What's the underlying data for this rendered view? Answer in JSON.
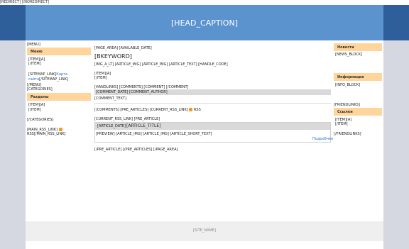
{
  "top": {
    "redirect": "[REDIRECT] [/NOREDIRECT]"
  },
  "header": {
    "caption": "[HEAD_CAPTION]"
  },
  "left": {
    "menu_tag": "[MENU]",
    "menu_title": "Меню",
    "menu_item_open": "[ITEM][A]",
    "menu_item_close": "[/ITEM]",
    "sitemap_open": "[SITEMAP_LINK]",
    "sitemap_link": "Карта",
    "sitemap_link2": "сайта",
    "sitemap_close": "[/SITEMAP_LINK]",
    "menu_close": "[/MENU]",
    "categories_tag": "[CATEGORIES]",
    "sections_title": "Разделы",
    "cat_item_open": "[ITEM][A]",
    "cat_item_close": "[/ITEM]",
    "categories_close": "[/CATEGORIES]",
    "main_rss": "[MAIN_RSS_LINK]",
    "main_rss_close": "RSS[/MAIN_RSS_LINK]"
  },
  "center": {
    "page_area": "[PAGE_AREA] [AVAILABLE_DATE]",
    "keyword": "[BKEYWORD]",
    "links_line": "[IMG_A_LT] [ARTICLE_IMG] [ARTICLE_IMG] [ARTICLE_TEXT] [HANDLE_CODE]",
    "item_a": "[ITEM][A]",
    "item_close": "[/ITEM]",
    "handlinks": "[HANDLINKS] [COMMENTS] [COMMENT] [/COMMENT]",
    "comment_row": "[COMMENT_DATE] [COMMENT_AUTHOR]",
    "comment_text": "[COMMENT_TEXT]",
    "comments_rss": "[/COMMENTS] [PRE_ARTICLES] [CURRENT_RSS_LINK]",
    "rss_word": "RSS",
    "current_rss": "[CURRENT_RSS_LINK] [PRE_ARTICLE]",
    "article_date": "[ARTICLE_DATE]",
    "article_title": "[ARTICLE_TITLE]",
    "article_short": "[PREVIEW] [ARTICLE_IMG] [ARTICLE_IMG] [ARTICLE_SHORT_TEXT]",
    "more_link": "Подробнее",
    "pre_article_close": "[/PRE_ARTICLE] [/PRE_ARTICLES] [/PAGE_AREA]"
  },
  "right": {
    "news_title": "Новости",
    "news_block": "[NEWS_BLOCK]",
    "info_title": "Информация",
    "info_block": "[INFO_BLOCK]",
    "friendlinks": "[FRIENDLINKS]",
    "links_title": "Ссылки",
    "link_item_open": "[ITEM][A]",
    "link_item_close": "[/ITEM]",
    "friendlinks_close": "[/FRIENDLINKS]"
  },
  "footer": {
    "site_name": "[SITE_NAME]"
  }
}
